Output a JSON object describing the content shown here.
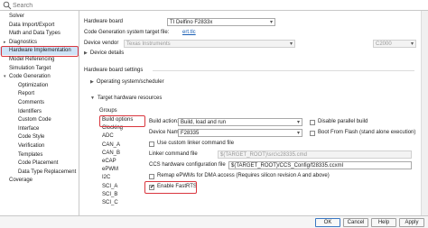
{
  "search": {
    "placeholder": "Search"
  },
  "tree": {
    "items": [
      {
        "label": "Solver",
        "indent": 0
      },
      {
        "label": "Data Import/Export",
        "indent": 0
      },
      {
        "label": "Math and Data Types",
        "indent": 0
      },
      {
        "label": "Diagnostics",
        "indent": 0,
        "arrow": "▸"
      },
      {
        "label": "Hardware Implementation",
        "indent": 0,
        "selected": true
      },
      {
        "label": "Model Referencing",
        "indent": 0
      },
      {
        "label": "Simulation Target",
        "indent": 0
      },
      {
        "label": "Code Generation",
        "indent": 0,
        "arrow": "▾"
      },
      {
        "label": "Optimization",
        "indent": 1
      },
      {
        "label": "Report",
        "indent": 1
      },
      {
        "label": "Comments",
        "indent": 1
      },
      {
        "label": "Identifiers",
        "indent": 1
      },
      {
        "label": "Custom Code",
        "indent": 1
      },
      {
        "label": "Interface",
        "indent": 1
      },
      {
        "label": "Code Style",
        "indent": 1
      },
      {
        "label": "Verification",
        "indent": 1
      },
      {
        "label": "Templates",
        "indent": 1
      },
      {
        "label": "Code Placement",
        "indent": 1
      },
      {
        "label": "Data Type Replacement",
        "indent": 1
      },
      {
        "label": "Coverage",
        "indent": 0
      }
    ]
  },
  "main": {
    "hardware_board_label": "Hardware board",
    "hardware_board_value": "TI Delfino F2833x",
    "codegen_target_label": "Code Generation system target file:",
    "codegen_target_link": "ert.tlc",
    "device_vendor_label": "Device vendor",
    "device_vendor_value": "Texas Instruments",
    "device_type_value": "C2000",
    "device_details": "Device details",
    "board_settings_label": "Hardware board settings",
    "os_scheduler": "Operating system/scheduler",
    "target_resources": "Target hardware resources",
    "groups_label": "Groups",
    "groups": [
      "Build options",
      "Clocking",
      "ADC",
      "CAN_A",
      "CAN_B",
      "eCAP",
      "ePWM",
      "I2C",
      "SCI_A",
      "SCI_B",
      "SCI_C"
    ],
    "build_action_label": "Build action:",
    "build_action_value": "Build, load and run",
    "disable_parallel": "Disable parallel build",
    "device_name_label": "Device Name",
    "device_name_value": "F28335",
    "boot_from_flash": "Boot From Flash (stand alone execution)",
    "custom_linker": "Use custom linker command file",
    "linker_label": "Linker command file",
    "linker_value": "$(TARGET_ROOT)\\src\\c28335.cmd",
    "ccs_label": "CCS hardware configuration file",
    "ccs_value": "$(TARGET_ROOT)/CCS_Config/f28335.ccxml",
    "remap_epwm": "Remap ePWMs for DMA access (Requires silicon revision A and above)",
    "enable_fastrts": "Enable FastRTS"
  },
  "footer": {
    "ok": "OK",
    "cancel": "Cancel",
    "help": "Help",
    "apply": "Apply"
  },
  "colors": {
    "highlight": "#d9363e",
    "selection": "#cfe3f7",
    "link": "#1a5fb4",
    "primary_border": "#3a78c3"
  }
}
